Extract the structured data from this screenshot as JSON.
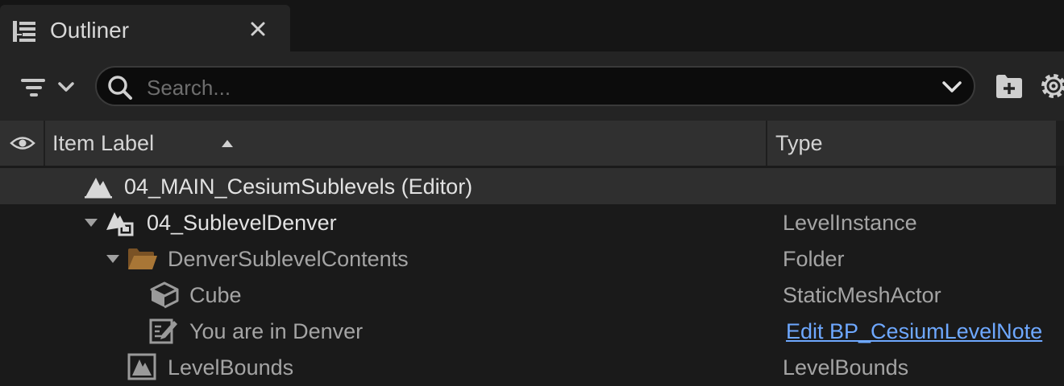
{
  "tab": {
    "title": "Outliner",
    "icon": "outliner-icon",
    "close_icon": "close-icon"
  },
  "toolbar": {
    "filter_icon": "filter-icon",
    "search": {
      "placeholder": "Search...",
      "value": ""
    },
    "add_folder_icon": "folder-add-icon",
    "settings_icon": "gear-icon"
  },
  "columns": {
    "visibility_icon": "eye-icon",
    "label": "Item Label",
    "sort": "ascending",
    "type": "Type"
  },
  "rows": [
    {
      "label": "04_MAIN_CesiumSublevels (Editor)",
      "type": "",
      "icon": "level-icon",
      "selected": true
    },
    {
      "label": "04_SublevelDenver",
      "type": "LevelInstance",
      "icon": "level-instance-icon",
      "expanded": true
    },
    {
      "label": "DenverSublevelContents",
      "type": "Folder",
      "icon": "folder-open-icon",
      "expanded": true
    },
    {
      "label": "Cube",
      "type": "StaticMeshActor",
      "icon": "cube-icon"
    },
    {
      "label": "You are in Denver",
      "type": "Edit BP_CesiumLevelNote",
      "icon": "note-edit-icon",
      "type_is_link": true
    },
    {
      "label": "LevelBounds",
      "type": "LevelBounds",
      "icon": "level-bounds-icon"
    }
  ],
  "colors": {
    "link": "#6ea8ff",
    "folder": "#9a6a2e",
    "background": "#1a1a1a",
    "panel": "#242424"
  }
}
